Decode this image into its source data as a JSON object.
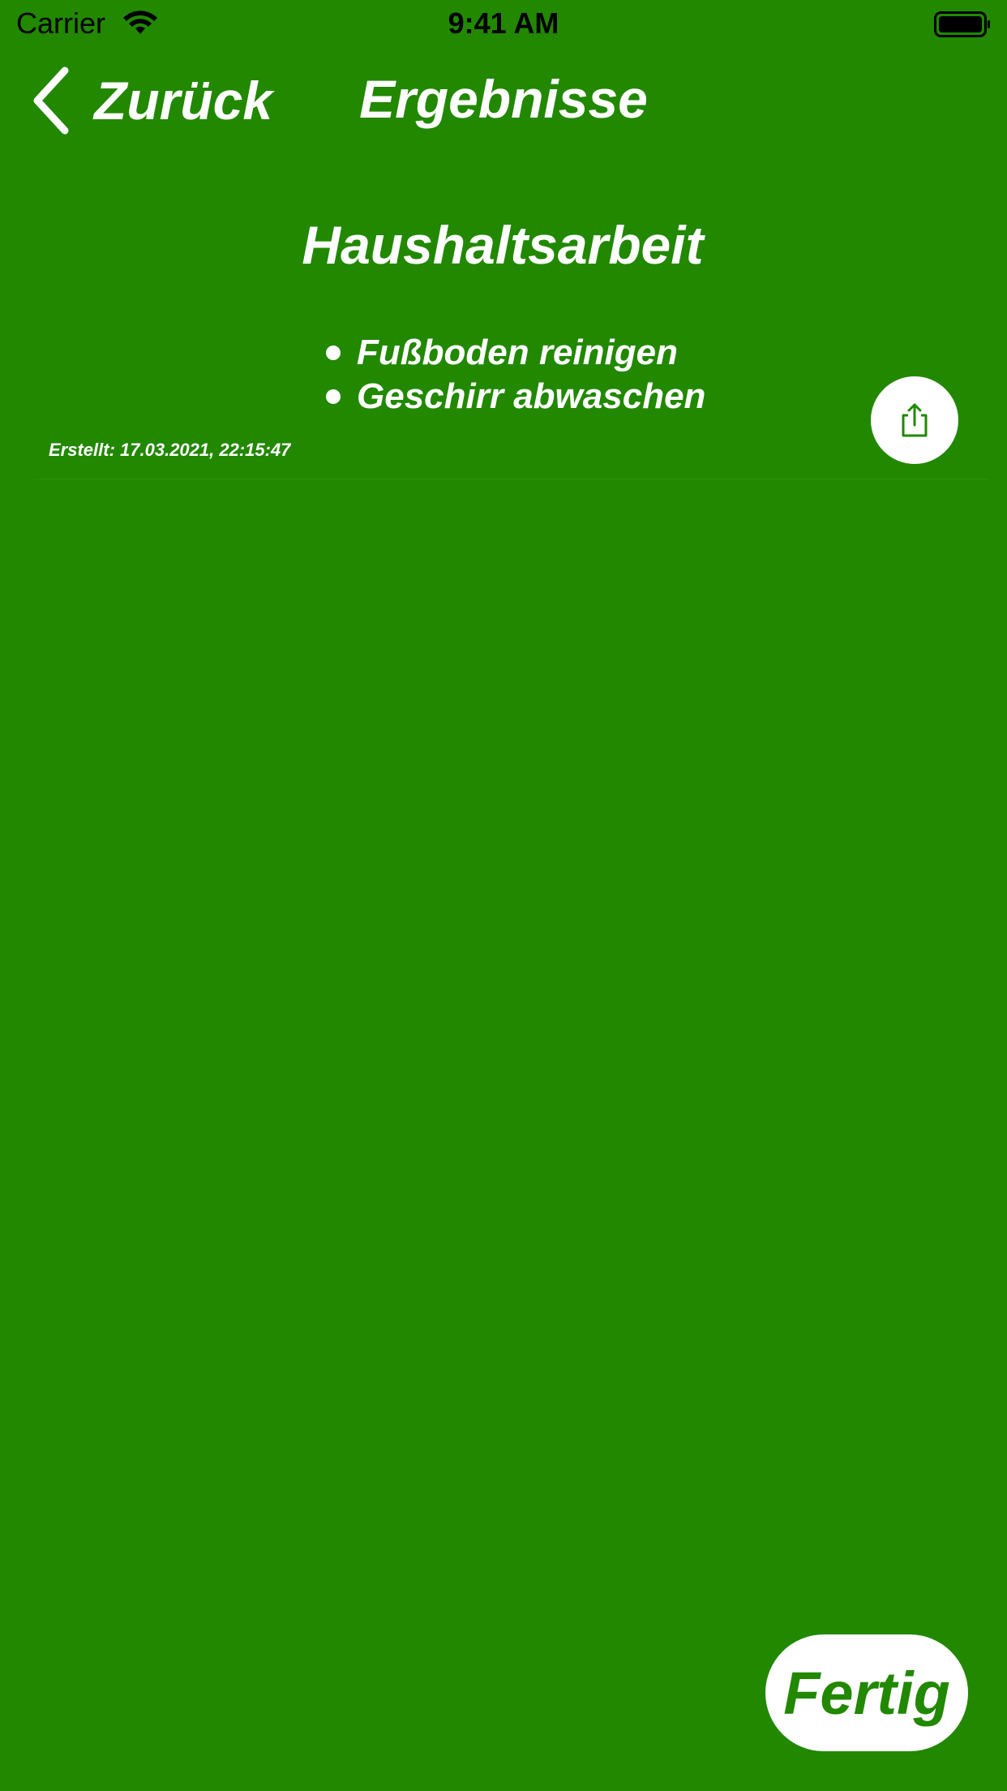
{
  "status_bar": {
    "carrier": "Carrier",
    "time": "9:41 AM"
  },
  "nav": {
    "back_label": "Zurück",
    "title": "Ergebnisse"
  },
  "result": {
    "title": "Haushaltsarbeit",
    "items": [
      "Fußboden reinigen",
      "Geschirr abwaschen"
    ],
    "created": "Erstellt: 17.03.2021, 22:15:47"
  },
  "done_button": {
    "label": "Fertig"
  },
  "colors": {
    "background": "#218800",
    "text": "#ffffff",
    "button_background": "#ffffff",
    "button_text": "#218800"
  }
}
